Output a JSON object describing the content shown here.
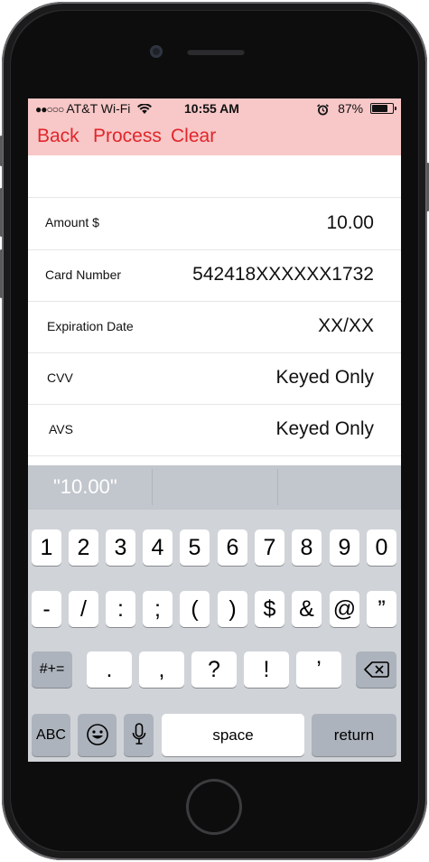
{
  "status_bar": {
    "signal_dots": "●●○○○",
    "carrier": "AT&T Wi-Fi",
    "wifi_icon": "wifi-icon",
    "time": "10:55 AM",
    "alarm_icon": "alarm-icon",
    "battery_text": "87%",
    "battery_level": 0.87
  },
  "nav": {
    "back": "Back",
    "process": "Process",
    "clear": "Clear",
    "accent_color": "#e0262b",
    "bar_color": "#f8c7c7"
  },
  "form": {
    "rows": [
      {
        "label": "Amount $",
        "value": "10.00"
      },
      {
        "label": "Card Number",
        "value": "542418XXXXXX1732"
      },
      {
        "label": "Expiration Date",
        "value": "XX/XX"
      },
      {
        "label": "CVV",
        "value": "Keyed Only"
      },
      {
        "label": "AVS",
        "value": "Keyed Only"
      }
    ]
  },
  "keyboard": {
    "suggestion": "\"10.00\"",
    "row1": [
      "1",
      "2",
      "3",
      "4",
      "5",
      "6",
      "7",
      "8",
      "9",
      "0"
    ],
    "row2": [
      "-",
      "/",
      ":",
      ";",
      "(",
      ")",
      "$",
      "&",
      "@",
      "”"
    ],
    "row3": [
      ".",
      ",",
      "?",
      "!",
      "’"
    ],
    "symbols_key": "#+=",
    "abc_key": "ABC",
    "space_key": "space",
    "return_key": "return",
    "delete_icon": "backspace-icon",
    "emoji_icon": "emoji-icon",
    "mic_icon": "microphone-icon"
  }
}
